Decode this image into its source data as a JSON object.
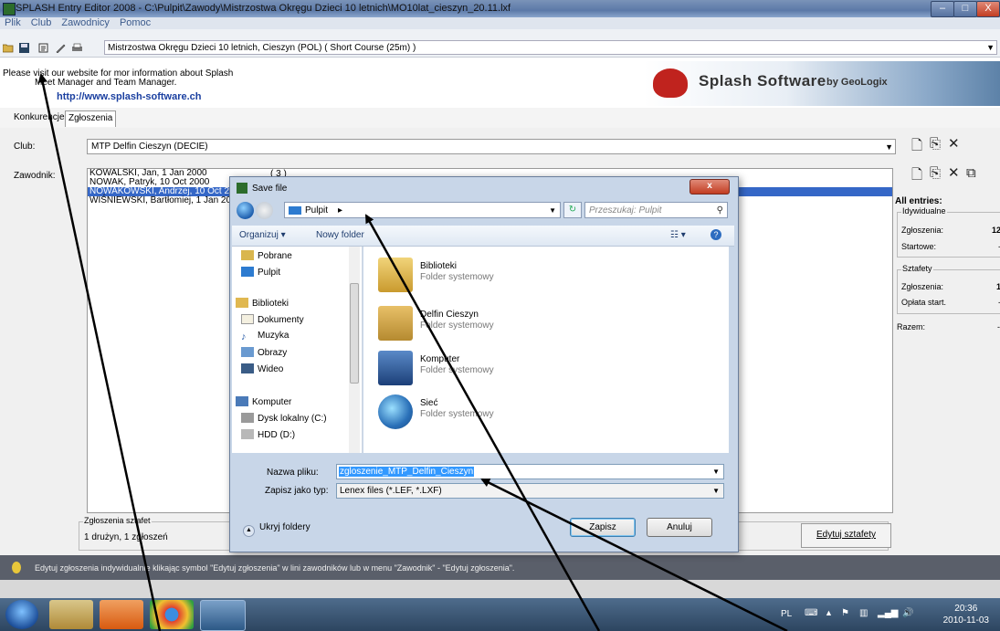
{
  "window": {
    "title": "SPLASH Entry Editor 2008 - C:\\Pulpit\\Zawody\\Mistrzostwa Okręgu Dzieci 10 letnich\\MO10lat_cieszyn_20.11.lxf",
    "minimize": "–",
    "maximize": "□",
    "close": "X"
  },
  "menu": [
    "Plik",
    "Club",
    "Zawodnicy",
    "Pomoc"
  ],
  "toolbar": {
    "meet": "Mistrzostwa Okręgu Dzieci 10 letnich,  Cieszyn  (POL)  ( Short Course (25m) )",
    "icons": [
      "open-folder-icon",
      "save-icon",
      "properties-icon",
      "edit-icon",
      "print-icon"
    ]
  },
  "info": {
    "line1": "Please visit our website for mor information about Splash",
    "line2": "Meet Manager and Team Manager.",
    "link": "http://www.splash-software.ch"
  },
  "banner": {
    "name": "Splash Software",
    "by": "by GeoLogix"
  },
  "tabs": [
    "Konkurencje",
    "Zgłoszenia"
  ],
  "club": {
    "label": "Club:",
    "value": "MTP Delfin Cieszyn (DECIE)"
  },
  "swimmers": {
    "label": "Zawodnik:",
    "count": "( 3 )",
    "rows": [
      "KOWALSKI, Jan, 1 Jan 2000",
      "NOWAK, Patryk, 10 Oct 2000",
      "NOWAKOWSKI, Andrzej, 10 Oct 2000",
      "WIŚNIEWSKI, Bartłomiej, 1 Jan 2000"
    ],
    "selected_index": 2
  },
  "summary": {
    "title": "All entries:",
    "individual_group": "Idywidualne",
    "individual_entries_label": "Zgłoszenia:",
    "individual_entries_value": "12",
    "individual_start_label": "Startowe:",
    "individual_start_value": "-",
    "relay_group": "Sztafety",
    "relay_entries_label": "Zgłoszenia:",
    "relay_entries_value": "1",
    "relay_fee_label": "Opłata start.",
    "relay_fee_value": "-",
    "total_label": "Razem:",
    "total_value": "-"
  },
  "relays": {
    "group": "Zgłoszenia sztafet",
    "text": "1 drużyn, 1 zgłoszeń",
    "button": "Edytuj sztafety"
  },
  "hint": "Edytuj zgłoszenia indywidualnie klikając symbol \"Edytuj zgłoszenia\" w lini zawodników lub w menu \"Zawodnik\" - \"Edytuj zgłoszenia\".",
  "taskbar": {
    "lang": "PL",
    "time": "20:36",
    "date": "2010-11-03"
  },
  "dialog": {
    "title": "Save file",
    "close": "x",
    "address": "Pulpit",
    "search_placeholder": "Przeszukaj: Pulpit",
    "toolbar": {
      "organize": "Organizuj ▾",
      "new_folder": "Nowy folder"
    },
    "nav": [
      {
        "label": "Pobrane",
        "icon": "downloads-folder-icon"
      },
      {
        "label": "Pulpit",
        "icon": "desktop-icon"
      },
      {
        "label": "Biblioteki",
        "icon": "libraries-icon"
      },
      {
        "label": "Dokumenty",
        "icon": "documents-icon"
      },
      {
        "label": "Muzyka",
        "icon": "music-icon"
      },
      {
        "label": "Obrazy",
        "icon": "pictures-icon"
      },
      {
        "label": "Wideo",
        "icon": "video-icon"
      },
      {
        "label": "Komputer",
        "icon": "computer-icon"
      },
      {
        "label": "Dysk lokalny (C:)",
        "icon": "drive-icon"
      },
      {
        "label": "HDD (D:)",
        "icon": "drive-icon"
      }
    ],
    "files": [
      {
        "name": "Biblioteki",
        "type": "Folder systemowy",
        "icon": "libraries-folder-icon"
      },
      {
        "name": "Delfin Cieszyn",
        "type": "Folder systemowy",
        "icon": "user-folder-icon"
      },
      {
        "name": "Komputer",
        "type": "Folder systemowy",
        "icon": "computer-icon"
      },
      {
        "name": "Sieć",
        "type": "Folder systemowy",
        "icon": "network-globe-icon"
      }
    ],
    "filename_label": "Nazwa pliku:",
    "filename": "zgloszenie_MTP_Delfin_Cieszyn",
    "filetype_label": "Zapisz jako typ:",
    "filetype": "Lenex files (*.LEF, *.LXF)",
    "hide_folders": "Ukryj foldery",
    "save": "Zapisz",
    "cancel": "Anuluj"
  }
}
